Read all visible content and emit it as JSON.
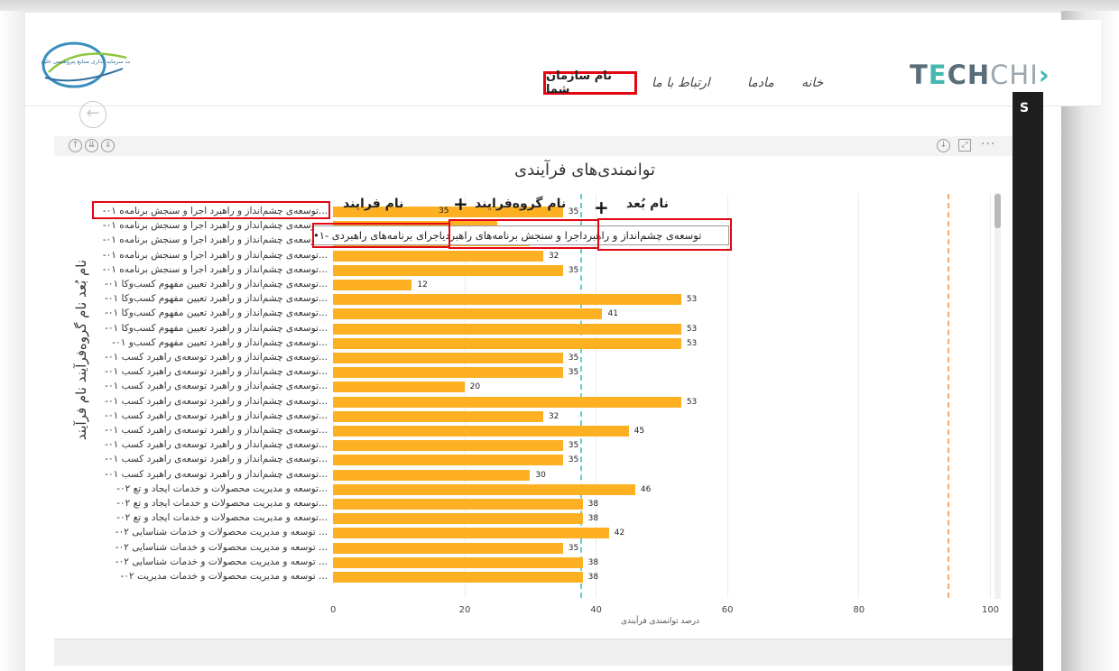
{
  "navbar": {
    "org_name": "نام سازمان شما",
    "contact": "ارتباط با ما",
    "about": "مادما",
    "home": "خانه",
    "brand": "TECHCHI"
  },
  "logo": {
    "text": "شرکت سرمایه گذاری صنایع پتروشیمی خلیج فارس"
  },
  "side_panel": {
    "letter": "S"
  },
  "chart_data": {
    "type": "bar",
    "orientation": "horizontal",
    "title": "توانمندی‌های فرآیندی",
    "xlabel": "درصد توانمندی فرآیندی",
    "ylabel": "نام بُعد نام گروه‌فرآیند نام فرآیند",
    "xlim": [
      0,
      100
    ],
    "xticks": [
      "0",
      "20",
      "40",
      "60",
      "80",
      "100"
    ],
    "categories": [
      "...توسعه‌ی چشم‌انداز و راهبرد اجرا و سنجش برنامه‌ه ۰۱-",
      "...توسعه‌ی چشم‌انداز و راهبرد اجرا و سنجش برنامه‌ه ۰۱-",
      "...توسعه‌ی چشم‌انداز و راهبرد اجرا و سنجش برنامه‌ه ۰۱-",
      "...توسعه‌ی چشم‌انداز و راهبرد اجرا و سنجش برنامه‌ه ۰۱-",
      "...توسعه‌ی چشم‌انداز و راهبرد اجرا و سنجش برنامه‌ه ۰۱-",
      "...توسعه‌ی چشم‌انداز و راهبرد تعیین مفهوم کسب‌وکا ۰۱-",
      "...توسعه‌ی چشم‌انداز و راهبرد تعیین مفهوم کسب‌وکا ۰۱-",
      "...توسعه‌ی چشم‌انداز و راهبرد تعیین مفهوم کسب‌وکا ۰۱-",
      "...توسعه‌ی چشم‌انداز و راهبرد تعیین مفهوم کسب‌وکا ۰۱-",
      "...توسعه‌ی چشم‌انداز و راهبرد تعیین مفهوم کسب‌و ۰۱-",
      "...توسعه‌ی چشم‌انداز و راهبرد توسعه‌ی راهبرد کسب ۰۱-",
      "...توسعه‌ی چشم‌انداز و راهبرد توسعه‌ی راهبرد کسب ۰۱-",
      "...توسعه‌ی چشم‌انداز و راهبرد توسعه‌ی راهبرد کسب ۰۱-",
      "...توسعه‌ی چشم‌انداز و راهبرد توسعه‌ی راهبرد کسب ۰۱-",
      "...توسعه‌ی چشم‌انداز و راهبرد توسعه‌ی راهبرد کسب ۰۱-",
      "...توسعه‌ی چشم‌انداز و راهبرد توسعه‌ی راهبرد کسب ۰۱-",
      "...توسعه‌ی چشم‌انداز و راهبرد توسعه‌ی راهبرد کسب ۰۱-",
      "...توسعه‌ی چشم‌انداز و راهبرد توسعه‌ی راهبرد کسب ۰۱-",
      "...توسعه‌ی چشم‌انداز و راهبرد توسعه‌ی راهبرد کسب ۰۱-",
      "...توسعه و مدیریت محصولات و خدمات ایجاد و تع ۰۲-",
      "...توسعه و مدیریت محصولات و خدمات ایجاد و تع ۰۲-",
      "...توسعه و مدیریت محصولات و خدمات ایجاد و تع ۰۲-",
      "... توسعه و مدیریت محصولات و خدمات شناسایی ۰۲-",
      "... توسعه و مدیریت محصولات و خدمات شناسایی ۰۲-",
      "... توسعه و مدیریت محصولات و خدمات شناسایی ۰۲-",
      "... توسعه و مدیریت محصولات و خدمات مدیریت ۰۲-"
    ],
    "values": [
      35,
      25,
      30,
      32,
      35,
      12,
      53,
      41,
      53,
      53,
      35,
      35,
      20,
      53,
      32,
      45,
      35,
      35,
      30,
      46,
      38,
      38,
      42,
      35,
      38,
      38
    ],
    "value_labels": [
      "35",
      "",
      "",
      "32",
      "35",
      "12",
      "53",
      "41",
      "53",
      "53",
      "35",
      "35",
      "20",
      "53",
      "32",
      "45",
      "35",
      "35",
      "30",
      "46",
      "38",
      "38",
      "42",
      "35",
      "38",
      "38"
    ],
    "grid": true
  },
  "annotations": {
    "dim_label": "نام بُعد",
    "group_label": "نام گروه‌فرایند",
    "process_label": "نام فرایند",
    "plus": "+",
    "tooltip_text": "توسعه‌ی چشم‌انداز و راهبرداجرا و سنجش برنامه‌های راهبردیاجرای برنامه‌های راهبردی -۱•",
    "tooltip_value": "35"
  },
  "colors": {
    "bar": "#fdb022",
    "highlight": "#e30613",
    "ref_line_1": "#5ecfd6",
    "ref_line_2": "#f7a96b"
  }
}
